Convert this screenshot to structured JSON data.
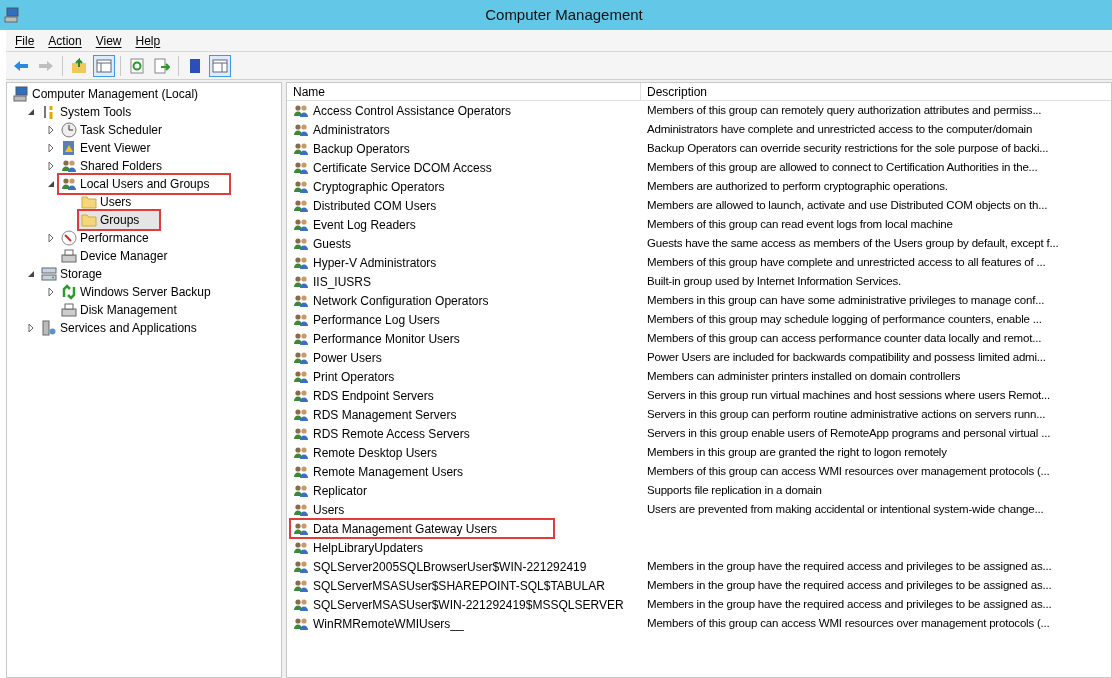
{
  "window": {
    "title": "Computer Management"
  },
  "menu": [
    "File",
    "Action",
    "View",
    "Help"
  ],
  "toolbar": [
    {
      "disabled": false,
      "pressed": false
    },
    {
      "disabled": true,
      "pressed": false
    },
    {
      "disabled": false,
      "pressed": false
    },
    {
      "disabled": false,
      "pressed": true
    },
    {
      "disabled": false,
      "pressed": false
    },
    {
      "disabled": false,
      "pressed": false
    },
    {
      "disabled": false,
      "pressed": false
    },
    {
      "disabled": false,
      "pressed": true
    }
  ],
  "tree": [
    {
      "label": "Computer Management (Local)",
      "selected": false,
      "highlighted": false,
      "children": [
        {
          "label": "System Tools",
          "expanded": true,
          "selected": false,
          "highlighted": false,
          "children": [
            {
              "label": "Task Scheduler",
              "expanded": false,
              "selected": false,
              "highlighted": false
            },
            {
              "label": "Event Viewer",
              "expanded": false,
              "selected": false,
              "highlighted": false
            },
            {
              "label": "Shared Folders",
              "expanded": false,
              "selected": false,
              "highlighted": false
            },
            {
              "label": "Local Users and Groups",
              "expanded": true,
              "selected": false,
              "highlighted": true,
              "children": [
                {
                  "label": "Users",
                  "selected": false,
                  "highlighted": false
                },
                {
                  "label": "Groups",
                  "selected": true,
                  "highlighted": true
                }
              ]
            },
            {
              "label": "Performance",
              "expanded": false,
              "selected": false,
              "highlighted": false
            },
            {
              "label": "Device Manager",
              "selected": false,
              "highlighted": false
            }
          ]
        },
        {
          "label": "Storage",
          "expanded": true,
          "selected": false,
          "highlighted": false,
          "children": [
            {
              "label": "Windows Server Backup",
              "expanded": false,
              "selected": false,
              "highlighted": false
            },
            {
              "label": "Disk Management",
              "selected": false,
              "highlighted": false
            }
          ]
        },
        {
          "label": "Services and Applications",
          "expanded": false,
          "selected": false,
          "highlighted": false
        }
      ]
    }
  ],
  "list": {
    "columns": [
      "Name",
      "Description"
    ],
    "rows": [
      {
        "name": "Access Control Assistance Operators",
        "description": "Members of this group can remotely query authorization attributes and permiss...",
        "highlighted": false
      },
      {
        "name": "Administrators",
        "description": "Administrators have complete and unrestricted access to the computer/domain",
        "highlighted": false
      },
      {
        "name": "Backup Operators",
        "description": "Backup Operators can override security restrictions for the sole purpose of backi...",
        "highlighted": false
      },
      {
        "name": "Certificate Service DCOM Access",
        "description": "Members of this group are allowed to connect to Certification Authorities in the...",
        "highlighted": false
      },
      {
        "name": "Cryptographic Operators",
        "description": "Members are authorized to perform cryptographic operations.",
        "highlighted": false
      },
      {
        "name": "Distributed COM Users",
        "description": "Members are allowed to launch, activate and use Distributed COM objects on th...",
        "highlighted": false
      },
      {
        "name": "Event Log Readers",
        "description": "Members of this group can read event logs from local machine",
        "highlighted": false
      },
      {
        "name": "Guests",
        "description": "Guests have the same access as members of the Users group by default, except f...",
        "highlighted": false
      },
      {
        "name": "Hyper-V Administrators",
        "description": "Members of this group have complete and unrestricted access to all features of ...",
        "highlighted": false
      },
      {
        "name": "IIS_IUSRS",
        "description": "Built-in group used by Internet Information Services.",
        "highlighted": false
      },
      {
        "name": "Network Configuration Operators",
        "description": "Members in this group can have some administrative privileges to manage conf...",
        "highlighted": false
      },
      {
        "name": "Performance Log Users",
        "description": "Members of this group may schedule logging of performance counters, enable ...",
        "highlighted": false
      },
      {
        "name": "Performance Monitor Users",
        "description": "Members of this group can access performance counter data locally and remot...",
        "highlighted": false
      },
      {
        "name": "Power Users",
        "description": "Power Users are included for backwards compatibility and possess limited admi...",
        "highlighted": false
      },
      {
        "name": "Print Operators",
        "description": "Members can administer printers installed on domain controllers",
        "highlighted": false
      },
      {
        "name": "RDS Endpoint Servers",
        "description": "Servers in this group run virtual machines and host sessions where users Remot...",
        "highlighted": false
      },
      {
        "name": "RDS Management Servers",
        "description": "Servers in this group can perform routine administrative actions on servers runn...",
        "highlighted": false
      },
      {
        "name": "RDS Remote Access Servers",
        "description": "Servers in this group enable users of RemoteApp programs and personal virtual ...",
        "highlighted": false
      },
      {
        "name": "Remote Desktop Users",
        "description": "Members in this group are granted the right to logon remotely",
        "highlighted": false
      },
      {
        "name": "Remote Management Users",
        "description": "Members of this group can access WMI resources over management protocols (...",
        "highlighted": false
      },
      {
        "name": "Replicator",
        "description": "Supports file replication in a domain",
        "highlighted": false
      },
      {
        "name": "Users",
        "description": "Users are prevented from making accidental or intentional system-wide change...",
        "highlighted": false
      },
      {
        "name": "Data Management Gateway Users",
        "highlighted": true
      },
      {
        "name": "HelpLibraryUpdaters",
        "highlighted": false
      },
      {
        "name": "SQLServer2005SQLBrowserUser$WIN-221292419",
        "description": "Members in the group have the required access and privileges to be assigned as...",
        "highlighted": false
      },
      {
        "name": "SQLServerMSASUser$SHAREPOINT-SQL$TABULAR",
        "description": "Members in the group have the required access and privileges to be assigned as...",
        "highlighted": false
      },
      {
        "name": "SQLServerMSASUser$WIN-221292419$MSSQLSERVER",
        "description": "Members in the group have the required access and privileges to be assigned as...",
        "highlighted": false
      },
      {
        "name": "WinRMRemoteWMIUsers__",
        "description": "Members of this group can access WMI resources over management protocols (...",
        "highlighted": false
      }
    ]
  }
}
